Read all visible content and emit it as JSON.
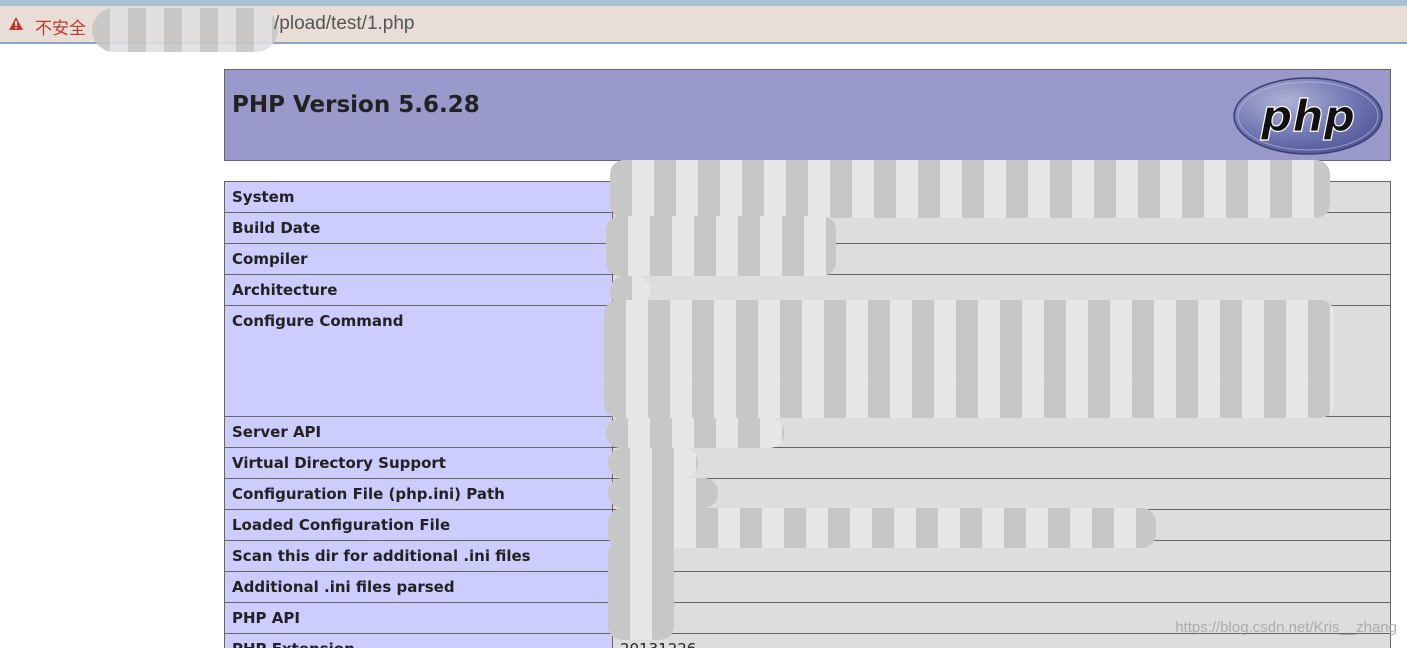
{
  "browser": {
    "security_label": "不安全",
    "url_visible": "/pload/test/1.php"
  },
  "header": {
    "title": "PHP Version 5.6.28",
    "logo_text": "php"
  },
  "rows": [
    {
      "key": "System",
      "value": ""
    },
    {
      "key": "Build Date",
      "value": ""
    },
    {
      "key": "Compiler",
      "value": ""
    },
    {
      "key": "Architecture",
      "value": ""
    },
    {
      "key": "Configure Command",
      "value": ""
    },
    {
      "key": "Server API",
      "value": ""
    },
    {
      "key": "Virtual Directory Support",
      "value": ""
    },
    {
      "key": "Configuration File (php.ini) Path",
      "value": ""
    },
    {
      "key": "Loaded Configuration File",
      "value": ""
    },
    {
      "key": "Scan this dir for additional .ini files",
      "value": ""
    },
    {
      "key": "Additional .ini files parsed",
      "value": ""
    },
    {
      "key": "PHP API",
      "value": ""
    },
    {
      "key": "PHP Extension",
      "value": "20131226"
    }
  ],
  "watermark": "https://blog.csdn.net/Kris__zhang",
  "colors": {
    "header_bg": "#9999cc",
    "key_bg": "#ccccff",
    "value_bg": "#dddddd",
    "warning": "#c0392b"
  }
}
